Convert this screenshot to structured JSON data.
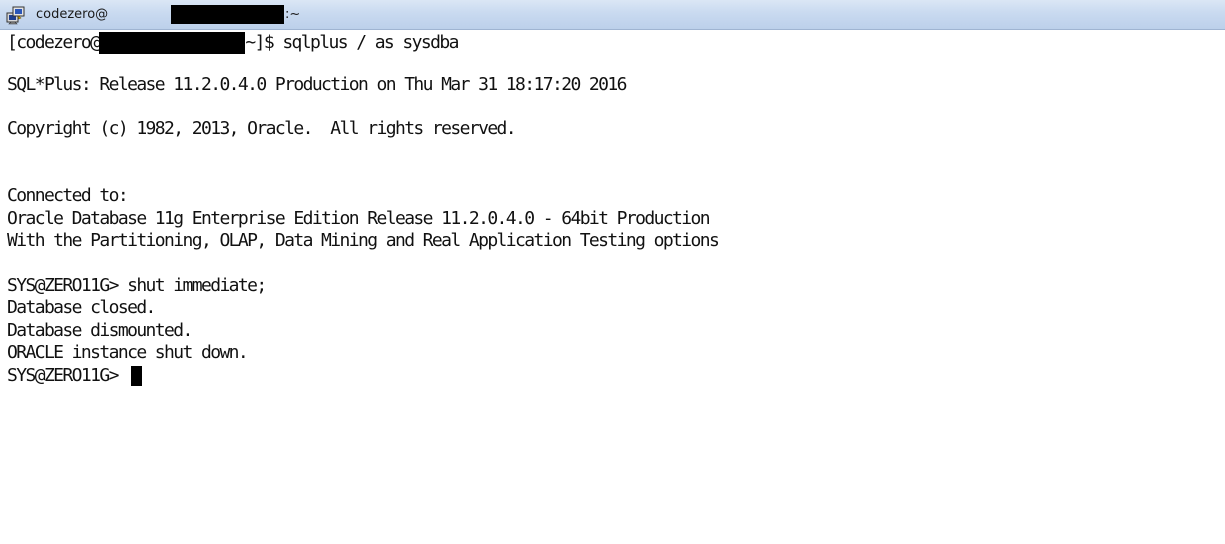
{
  "window": {
    "title_user": "codezero@",
    "title_suffix": ":~"
  },
  "terminal": {
    "prompt_prefix": "[codezero@",
    "prompt_command": "~]$ sqlplus / as sysdba",
    "lines": [
      "SQL*Plus: Release 11.2.0.4.0 Production on Thu Mar 31 18:17:20 2016",
      "Copyright (c) 1982, 2013, Oracle.  All rights reserved.",
      "Connected to:",
      "Oracle Database 11g Enterprise Edition Release 11.2.0.4.0 - 64bit Production",
      "With the Partitioning, OLAP, Data Mining and Real Application Testing options",
      "SYS@ZERO11G> shut immediate;",
      "Database closed.",
      "Database dismounted.",
      "ORACLE instance shut down.",
      "SYS@ZERO11G> "
    ]
  }
}
